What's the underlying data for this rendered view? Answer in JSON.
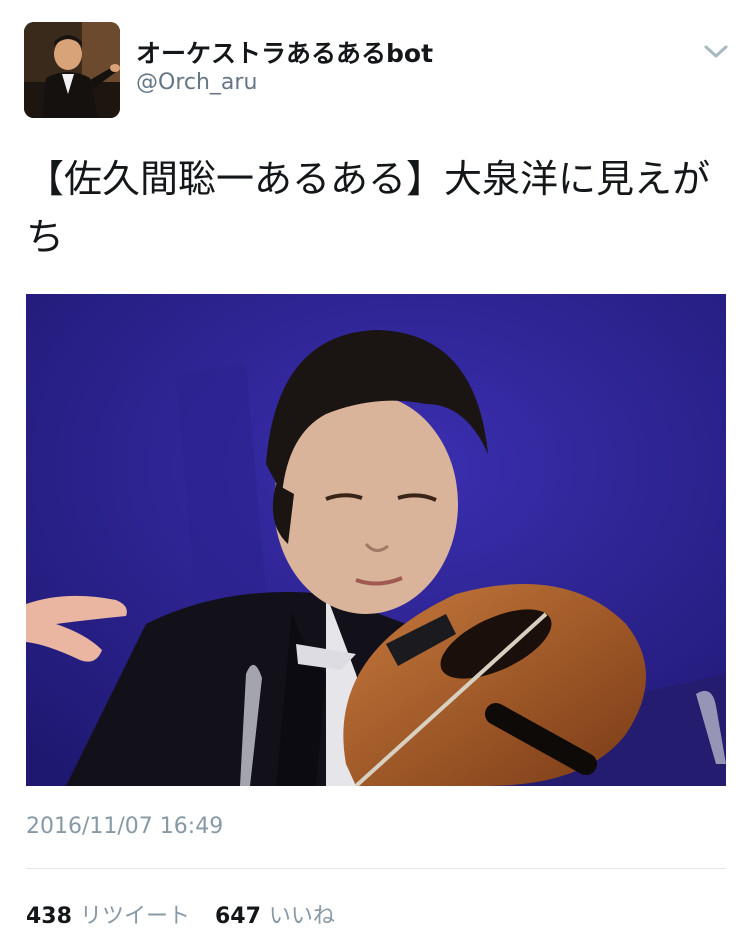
{
  "user": {
    "display_name": "オーケストラあるあるbot",
    "handle": "@Orch_aru"
  },
  "tweet": {
    "text": "【佐久間聡一あるある】大泉洋に見えがち",
    "timestamp": "2016/11/07 16:49"
  },
  "stats": {
    "retweets_count": "438",
    "retweets_label": "リツイート",
    "likes_count": "647",
    "likes_label": "いいね"
  },
  "icons": {
    "more": "chevron-down-icon"
  },
  "colors": {
    "text": "#14171a",
    "secondary": "#657786",
    "muted": "#8899a6",
    "divider": "#e1e8ed",
    "media_background": "#2a2085"
  }
}
